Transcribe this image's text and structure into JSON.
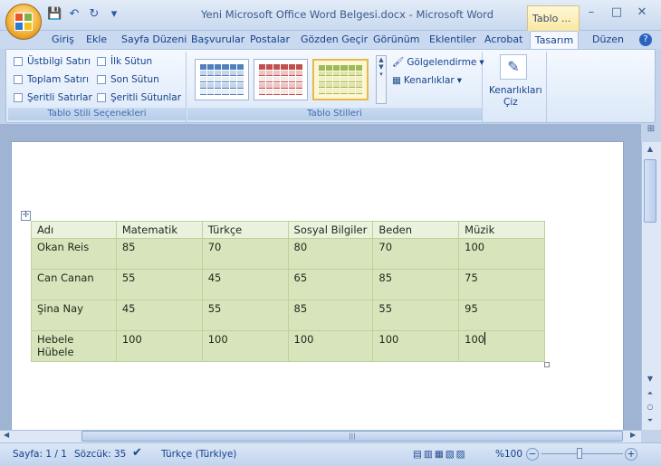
{
  "window": {
    "title": "Yeni Microsoft Office Word Belgesi.docx - Microsoft Word",
    "context_tab": "Tablo ...",
    "controls": {
      "minimize": "–",
      "maximize": "□",
      "close": "✕"
    }
  },
  "quick_access": {
    "save": "💾",
    "undo": "↶",
    "redo": "↻",
    "customize": "▾"
  },
  "tabs": [
    "Giriş",
    "Ekle",
    "Sayfa Düzeni",
    "Başvurular",
    "Postalar",
    "Gözden Geçir",
    "Görünüm",
    "Eklentiler",
    "Acrobat",
    "Tasarım",
    "Düzen"
  ],
  "active_tab": "Tasarım",
  "help_icon": "?",
  "ribbon": {
    "style_options": {
      "label": "Tablo Stili Seçenekleri",
      "items": [
        "Üstbilgi Satırı",
        "İlk Sütun",
        "Toplam Satırı",
        "Son Sütun",
        "Şeritli Satırlar",
        "Şeritli Sütunlar"
      ]
    },
    "table_styles": {
      "label": "Tablo Stilleri",
      "swatch_colors": [
        "#4f81bd",
        "#c0504d",
        "#9bbb59"
      ],
      "shading_label": "Gölgelendirme",
      "borders_label": "Kenarlıklar"
    },
    "draw_borders": {
      "label_line1": "Kenarlıkları",
      "label_line2": "Çiz"
    }
  },
  "table": {
    "headers": [
      "Adı",
      "Matematik",
      "Türkçe",
      "Sosyal Bilgiler",
      "Beden",
      "Müzik"
    ],
    "rows": [
      [
        "Okan Reis",
        "85",
        "70",
        "80",
        "70",
        "100"
      ],
      [
        "Can Canan",
        "55",
        "45",
        "65",
        "85",
        "75"
      ],
      [
        "Şina Nay",
        "45",
        "55",
        "85",
        "55",
        "95"
      ],
      [
        "Hebele Hübele",
        "100",
        "100",
        "100",
        "100",
        "100"
      ]
    ]
  },
  "status": {
    "page": "Sayfa: 1 / 1",
    "words": "Sözcük: 35",
    "language": "Türkçe (Türkiye)",
    "zoom": "%100",
    "zoom_minus": "−",
    "zoom_plus": "+"
  }
}
